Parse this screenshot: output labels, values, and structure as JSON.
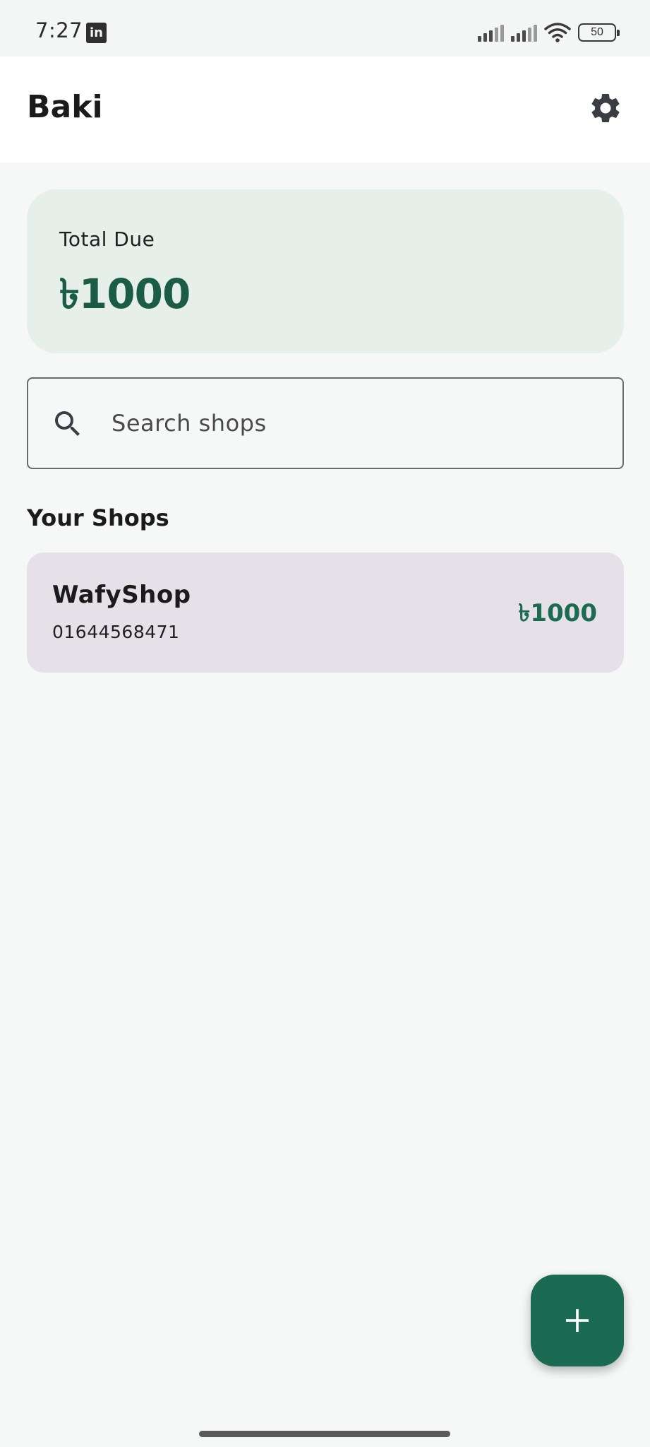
{
  "status_bar": {
    "time": "7:27",
    "notification_icon": "linkedin-icon",
    "battery_level": "50",
    "icons": [
      "cellular-signal-icon",
      "cellular-signal-icon",
      "wifi-icon",
      "battery-icon"
    ]
  },
  "app_bar": {
    "title": "Baki",
    "settings_icon": "gear-icon"
  },
  "summary": {
    "label": "Total Due",
    "amount": "৳1000"
  },
  "search": {
    "placeholder": "Search shops",
    "value": "",
    "icon": "search-icon"
  },
  "shops_section": {
    "title": "Your Shops",
    "items": [
      {
        "name": "WafyShop",
        "phone": "01644568471",
        "due": "৳1000"
      }
    ]
  },
  "fab": {
    "icon": "plus-icon"
  },
  "colors": {
    "accent": "#1b6b52",
    "amount_text": "#1a5c45",
    "summary_card": "#e6efea",
    "shop_card": "#e6e1e8",
    "background": "#f6f8f7"
  }
}
